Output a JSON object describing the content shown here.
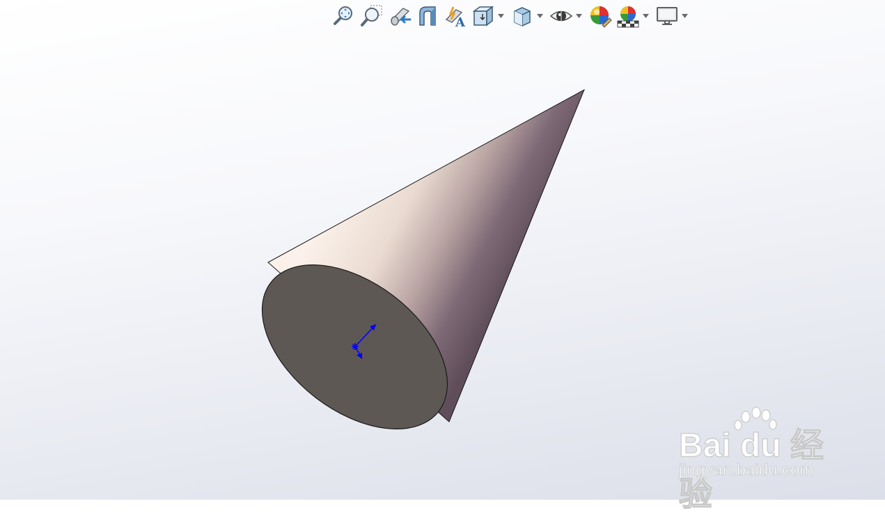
{
  "viewport": {
    "background_top": "#ffffff",
    "background_bottom": "#dcdfe9"
  },
  "toolbar": {
    "buttons": [
      {
        "icon": "zoom-to-fit-icon",
        "has_dropdown": false
      },
      {
        "icon": "zoom-to-area-icon",
        "has_dropdown": false
      },
      {
        "icon": "previous-view-icon",
        "has_dropdown": false
      },
      {
        "icon": "section-view-icon",
        "has_dropdown": false
      },
      {
        "icon": "dynamic-annotation-views-icon",
        "has_dropdown": false
      },
      {
        "icon": "view-orientation-icon",
        "has_dropdown": true
      },
      {
        "icon": "display-style-icon",
        "has_dropdown": true
      },
      {
        "icon": "hide-show-items-icon",
        "has_dropdown": true
      },
      {
        "icon": "edit-appearance-icon",
        "has_dropdown": false
      },
      {
        "icon": "apply-scene-icon",
        "has_dropdown": true
      },
      {
        "icon": "view-settings-icon",
        "has_dropdown": true
      }
    ]
  },
  "model": {
    "shape": "cone",
    "shaded_light": "#f8ece4",
    "shaded_dark": "#5f4e5a",
    "base_face_color": "#5e5855",
    "triad_color": "#0000ff"
  },
  "watermark": {
    "brand_text": "Bai du 经验",
    "url_text": "jingyan.baidu.com"
  }
}
